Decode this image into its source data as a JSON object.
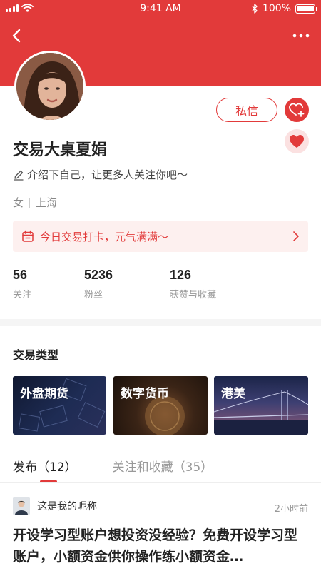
{
  "status_bar": {
    "time": "9:41 AM",
    "battery": "100%"
  },
  "profile": {
    "name": "交易大桌夏娟",
    "bio": "介绍下自己，让更多人关注你吧～",
    "gender": "女",
    "location": "上海",
    "message_label": "私信"
  },
  "checkin": {
    "label": "今日交易打卡，元气满满～"
  },
  "stats": [
    {
      "value": "56",
      "label": "关注"
    },
    {
      "value": "5236",
      "label": "粉丝"
    },
    {
      "value": "126",
      "label": "获赞与收藏"
    }
  ],
  "trade_types": {
    "title": "交易类型",
    "items": [
      {
        "label": "外盘期货"
      },
      {
        "label": "数字货币"
      },
      {
        "label": "港美"
      }
    ]
  },
  "tabs": [
    {
      "label": "发布（12）",
      "active": true
    },
    {
      "label": "关注和收藏（35）",
      "active": false
    }
  ],
  "post": {
    "author": "这是我的昵称",
    "time": "2小时前",
    "title": "开设学习型账户想投资没经验？免费开设学习型账户，小额资金供你操作练小额资金…"
  },
  "colors": {
    "accent": "#e23a3a",
    "checkin_bg": "#fdf0ef"
  },
  "icons": [
    "back-icon",
    "more-icon",
    "edit-icon",
    "calendar-icon",
    "chevron-right-icon",
    "heart-add-icon",
    "heart-icon"
  ]
}
